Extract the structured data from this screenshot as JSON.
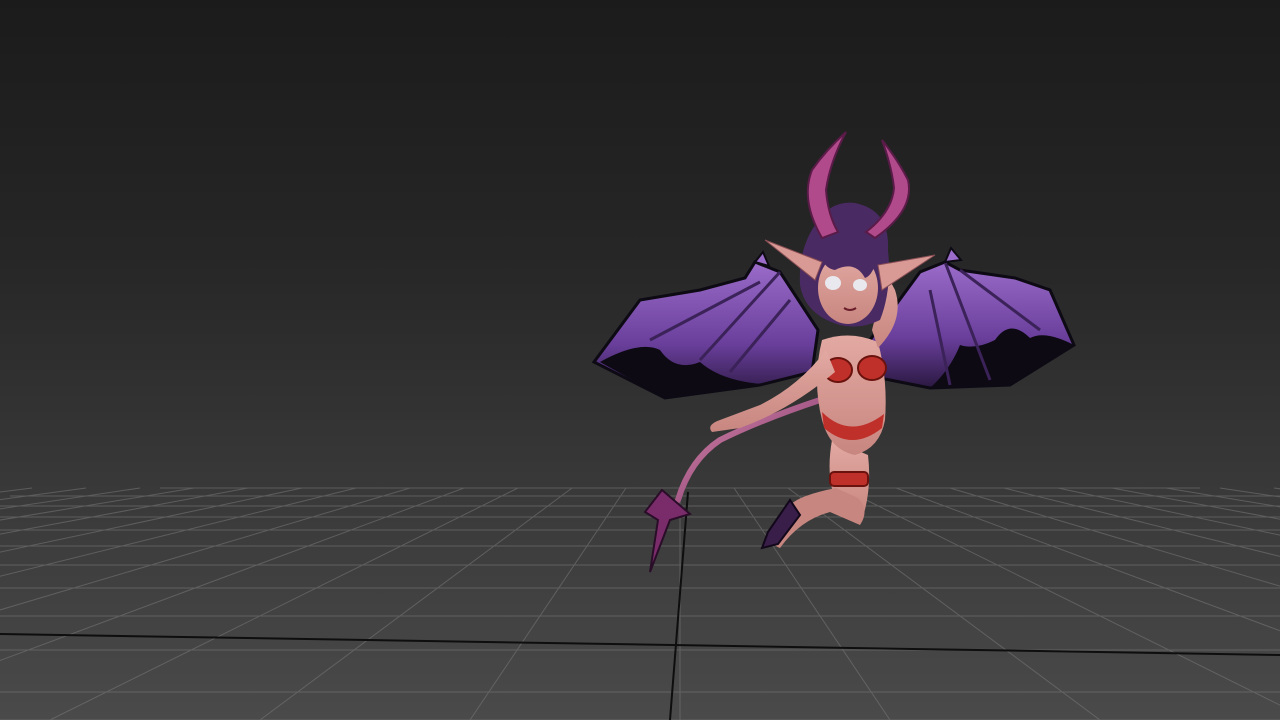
{
  "app": {
    "view": "3D viewport",
    "background_top": "#1b1b1b",
    "background_bottom": "#4a4a4a"
  },
  "viewport": {
    "grid": "on",
    "grid_color": "#7a7a7a",
    "axis_color": "#0e0e0e",
    "subject": "devil-girl-character-model",
    "colors": {
      "wing_membrane": "#7a4fb0",
      "wing_edge": "#0d0a14",
      "skin": "#d99a95",
      "hair": "#4a2a63",
      "horns": "#b04a8a",
      "outfit": "#c0302a"
    }
  }
}
